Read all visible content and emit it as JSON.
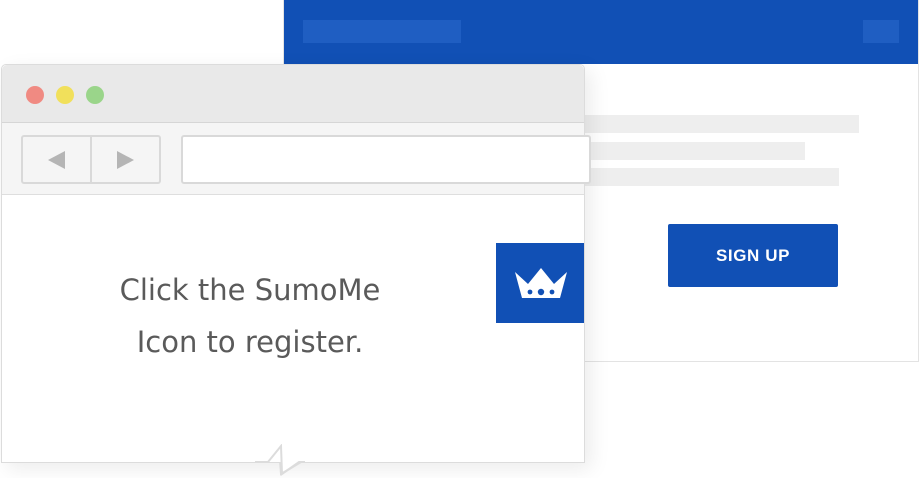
{
  "back_window": {
    "header_color": "#1150b5",
    "signup_button": {
      "label": "SIGN UP"
    }
  },
  "browser": {
    "traffic_lights": {
      "close_color": "#f08a82",
      "minimize_color": "#f1e05b",
      "maximize_color": "#9ad58a"
    },
    "toolbar": {
      "back_icon": "arrow-left-icon",
      "forward_icon": "arrow-right-icon",
      "address_value": ""
    },
    "content": {
      "message_line1": "Click the SumoMe",
      "message_line2": "Icon to register.",
      "sumome_icon": "crown-icon",
      "accent_color": "#1150b5"
    }
  }
}
